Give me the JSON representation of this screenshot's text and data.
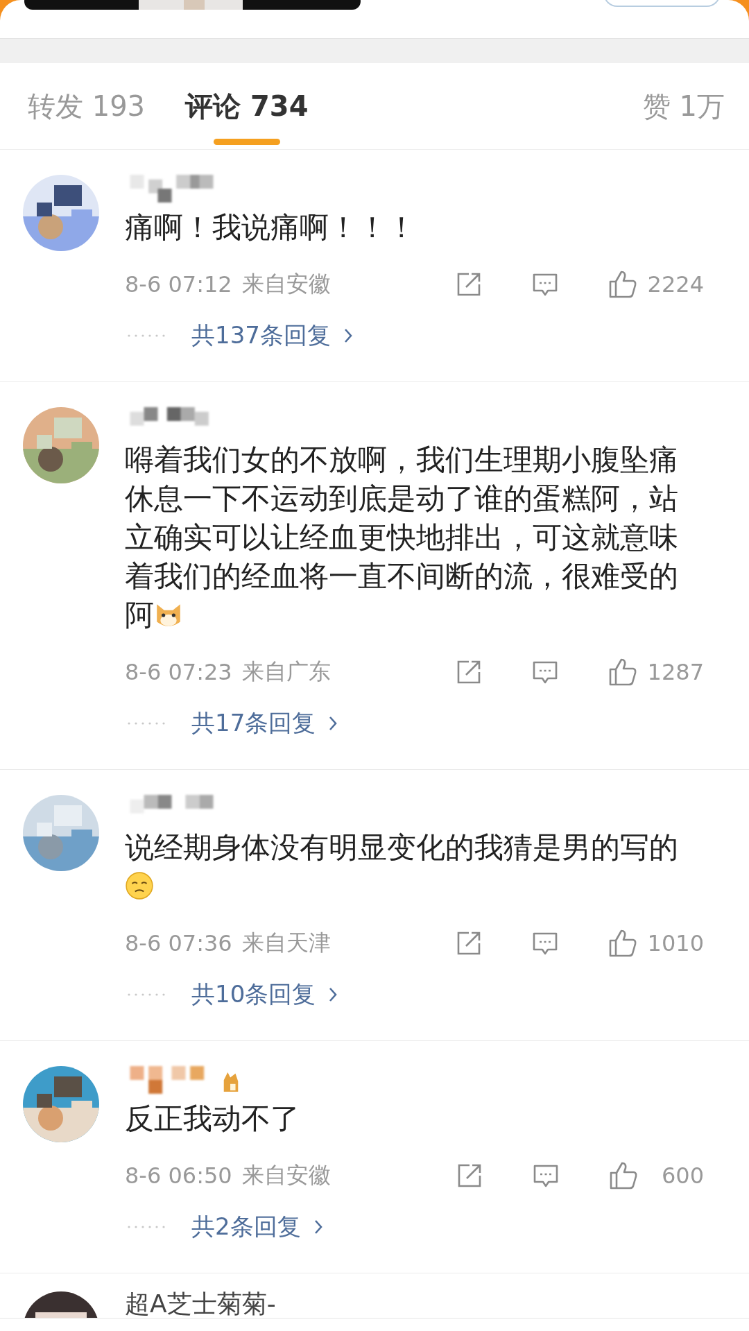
{
  "tabs": [
    {
      "label": "转发 193",
      "selected": false
    },
    {
      "label": "评论 734",
      "selected": true
    },
    {
      "label": "赞 1万",
      "selected": false
    }
  ],
  "comments": [
    {
      "badge": false,
      "text": "痛啊！我说痛啊！！！",
      "time": "8-6 07:12",
      "location": "来自安徽",
      "likes": "2224",
      "replies": "共137条回复"
    },
    {
      "badge": false,
      "text": "嘚着我们女的不放啊，我们生理期小腹坠痛休息一下不运动到底是动了谁的蛋糕阿，站立确实可以让经血更快地排出，可这就意味着我们的经血将一直不间断的流，很难受的阿",
      "emoji": {
        "kind": "dog"
      },
      "time": "8-6 07:23",
      "location": "来自广东",
      "likes": "1287",
      "replies": "共17条回复"
    },
    {
      "badge": false,
      "text": "说经期身体没有明显变化的我猜是男的写的",
      "emoji": {
        "kind": "face"
      },
      "time": "8-6 07:36",
      "location": "来自天津",
      "likes": "1010",
      "replies": "共10条回复"
    },
    {
      "badge": true,
      "text": "反正我动不了",
      "time": "8-6 06:50",
      "location": "来自安徽",
      "likes": "600",
      "replies": "共2条回复"
    }
  ],
  "next_comment": {
    "name": "超A芝士菊菊-"
  }
}
